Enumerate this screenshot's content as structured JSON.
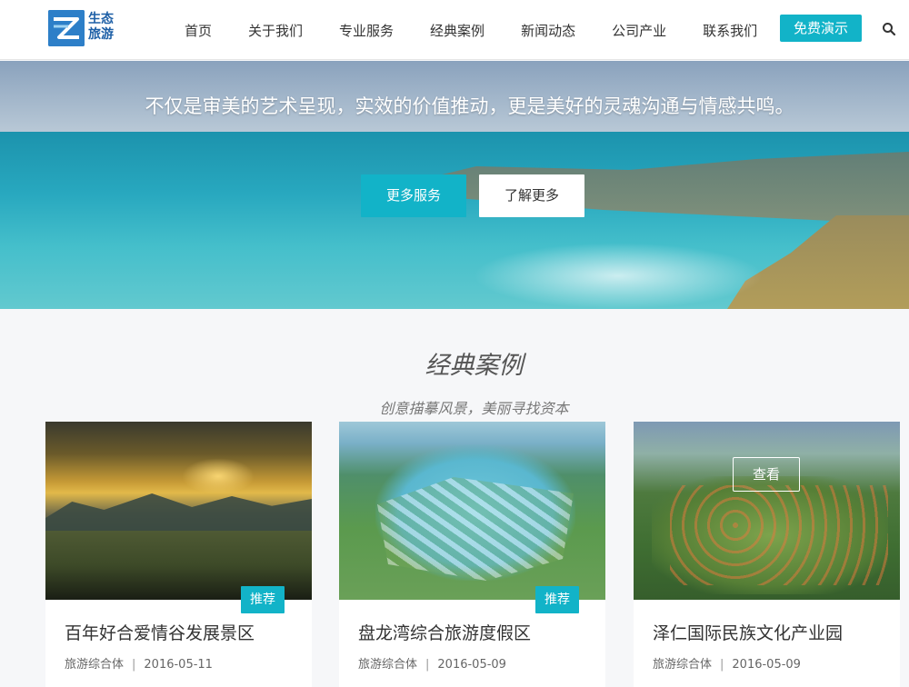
{
  "brand": {
    "line1": "生态",
    "line2": "旅游",
    "accent_color": "#12b3c8"
  },
  "nav": {
    "items": [
      "首页",
      "关于我们",
      "专业服务",
      "经典案例",
      "新闻动态",
      "公司产业",
      "联系我们"
    ],
    "demo_label": "免费演示",
    "search_icon": "search-icon"
  },
  "hero": {
    "title": "不仅是审美的艺术呈现，实效的价值推动，更是美好的灵魂沟通与情感共鸣。",
    "primary_label": "更多服务",
    "secondary_label": "了解更多"
  },
  "cases": {
    "title": "经典案例",
    "subtitle": "创意描摹风景，美丽寻找资本",
    "items": [
      {
        "name": "百年好合爱情谷发展景区",
        "category": "旅游综合体",
        "date": "2016-05-11",
        "badge": "推荐"
      },
      {
        "name": "盘龙湾综合旅游度假区",
        "category": "旅游综合体",
        "date": "2016-05-09",
        "badge": "推荐"
      },
      {
        "name": "泽仁国际民族文化产业园",
        "category": "旅游综合体",
        "date": "2016-05-09",
        "overlay_label": "查看"
      }
    ],
    "separator": "|"
  }
}
